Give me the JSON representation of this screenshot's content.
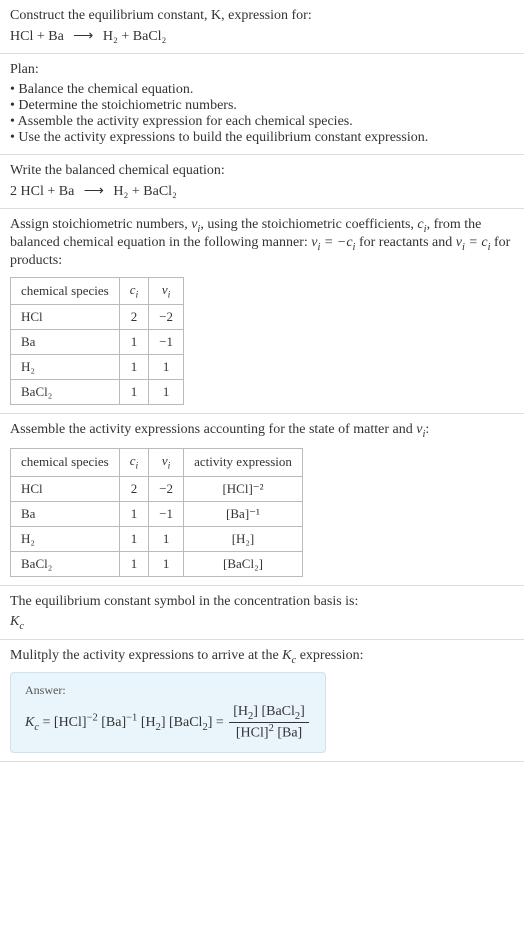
{
  "intro": {
    "text": "Construct the equilibrium constant, K, expression for:",
    "eq_lhs": "HCl + Ba",
    "eq_rhs": "H₂ + BaCl₂"
  },
  "plan": {
    "heading": "Plan:",
    "items": [
      "Balance the chemical equation.",
      "Determine the stoichiometric numbers.",
      "Assemble the activity expression for each chemical species.",
      "Use the activity expressions to build the equilibrium constant expression."
    ]
  },
  "balanced": {
    "heading": "Write the balanced chemical equation:",
    "eq_lhs": "2 HCl + Ba",
    "eq_rhs": "H₂ + BaCl₂"
  },
  "stoich": {
    "heading_a": "Assign stoichiometric numbers, ",
    "heading_b": ", using the stoichiometric coefficients, ",
    "heading_c": ", from the balanced chemical equation in the following manner: ",
    "heading_d": " for reactants and ",
    "heading_e": " for products:",
    "cols": [
      "chemical species",
      "cᵢ",
      "νᵢ"
    ],
    "rows": [
      [
        "HCl",
        "2",
        "−2"
      ],
      [
        "Ba",
        "1",
        "−1"
      ],
      [
        "H₂",
        "1",
        "1"
      ],
      [
        "BaCl₂",
        "1",
        "1"
      ]
    ]
  },
  "activity": {
    "heading": "Assemble the activity expressions accounting for the state of matter and νᵢ:",
    "cols": [
      "chemical species",
      "cᵢ",
      "νᵢ",
      "activity expression"
    ],
    "rows": [
      [
        "HCl",
        "2",
        "−2",
        "[HCl]⁻²"
      ],
      [
        "Ba",
        "1",
        "−1",
        "[Ba]⁻¹"
      ],
      [
        "H₂",
        "1",
        "1",
        "[H₂]"
      ],
      [
        "BaCl₂",
        "1",
        "1",
        "[BaCl₂]"
      ]
    ]
  },
  "kc_symbol": {
    "heading": "The equilibrium constant symbol in the concentration basis is:",
    "symbol": "K𝑐"
  },
  "final": {
    "heading": "Mulitply the activity expressions to arrive at the K𝑐 expression:",
    "answer_label": "Answer:",
    "expr_lhs": "K𝑐 = [HCl]⁻² [Ba]⁻¹ [H₂] [BaCl₂] = ",
    "frac_num": "[H₂] [BaCl₂]",
    "frac_den": "[HCl]² [Ba]"
  },
  "chart_data": {
    "type": "table",
    "tables": [
      {
        "title": "Stoichiometric numbers",
        "columns": [
          "chemical species",
          "c_i",
          "ν_i"
        ],
        "rows": [
          {
            "species": "HCl",
            "c_i": 2,
            "nu_i": -2
          },
          {
            "species": "Ba",
            "c_i": 1,
            "nu_i": -1
          },
          {
            "species": "H2",
            "c_i": 1,
            "nu_i": 1
          },
          {
            "species": "BaCl2",
            "c_i": 1,
            "nu_i": 1
          }
        ]
      },
      {
        "title": "Activity expressions",
        "columns": [
          "chemical species",
          "c_i",
          "ν_i",
          "activity expression"
        ],
        "rows": [
          {
            "species": "HCl",
            "c_i": 2,
            "nu_i": -2,
            "activity": "[HCl]^-2"
          },
          {
            "species": "Ba",
            "c_i": 1,
            "nu_i": -1,
            "activity": "[Ba]^-1"
          },
          {
            "species": "H2",
            "c_i": 1,
            "nu_i": 1,
            "activity": "[H2]"
          },
          {
            "species": "BaCl2",
            "c_i": 1,
            "nu_i": 1,
            "activity": "[BaCl2]"
          }
        ]
      }
    ]
  }
}
